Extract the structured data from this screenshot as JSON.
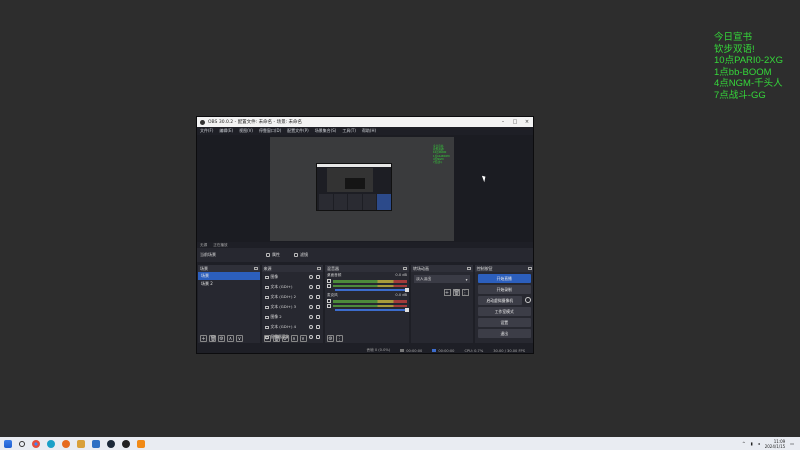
{
  "desktop": {
    "overlay_lines": [
      "今日宣书",
      "钦步双语!",
      "10点PARI0-2XG",
      "1点bb-BOOM",
      "4点NGM-千头人",
      "7点战斗-GG"
    ]
  },
  "obs": {
    "title": "OBS 30.0.2 - 配置文件: 未命名 - 场景: 未命名",
    "menu": [
      "文件(F)",
      "编辑(E)",
      "视图(V)",
      "停靠窗口(D)",
      "配置文件(P)",
      "场景集合(S)",
      "工具(T)",
      "帮助(H)"
    ],
    "preview_overlay_lines": [
      "今日宣书",
      "钦步双语!",
      "10点PARI0",
      "1点bb-BOOM",
      "4点NGM",
      "7点战斗"
    ],
    "status_top": [
      "无源",
      "正在播放"
    ],
    "scene_bar": {
      "current_scene": "当前场景",
      "properties_label": "属性",
      "filters_label": "滤镜"
    },
    "docks": {
      "scenes": {
        "title": "场景",
        "items": [
          "场景",
          "场景 2"
        ],
        "footer": [
          "+",
          "🗑",
          "⚙",
          "∧",
          "∨"
        ]
      },
      "sources": {
        "title": "来源",
        "items": [
          "图像",
          "文本 (GDI+)",
          "文本 (GDI+) 2",
          "文本 (GDI+) 3",
          "图像 2",
          "文本 (GDI+) 4",
          "显示器采集"
        ],
        "footer": [
          "+",
          "🗑",
          "⚙",
          "∧",
          "∨"
        ]
      },
      "mixer": {
        "title": "混音器",
        "channels": [
          {
            "name": "桌面音频",
            "db": "0.0 dB"
          },
          {
            "name": "麦克风",
            "db": "0.0 dB"
          }
        ],
        "footer": [
          "⚙",
          "⋮"
        ]
      },
      "transitions": {
        "title": "转场动画",
        "selected": "淡入淡出",
        "footer": [
          "+",
          "🗑",
          "⋮"
        ]
      },
      "controls": {
        "title": "控制按钮",
        "buttons": [
          "开始直播",
          "开始录制",
          "启动虚拟摄像机",
          "工作室模式",
          "设置",
          "退出"
        ]
      }
    },
    "status_bar": {
      "items": [
        "丢帧 0 (0.0%)",
        "00:00:00",
        "00:00:00",
        "CPU: 0.7%",
        "30.00 / 30.00 FPS"
      ]
    }
  },
  "taskbar": {
    "icons": [
      "start-icon",
      "search-icon",
      "chrome-icon",
      "edge-icon",
      "firefox-icon",
      "mail-icon",
      "photo-icon",
      "steam-icon",
      "obs-icon",
      "vlc-icon"
    ],
    "time": "11:09",
    "date": "2024/1/15"
  }
}
